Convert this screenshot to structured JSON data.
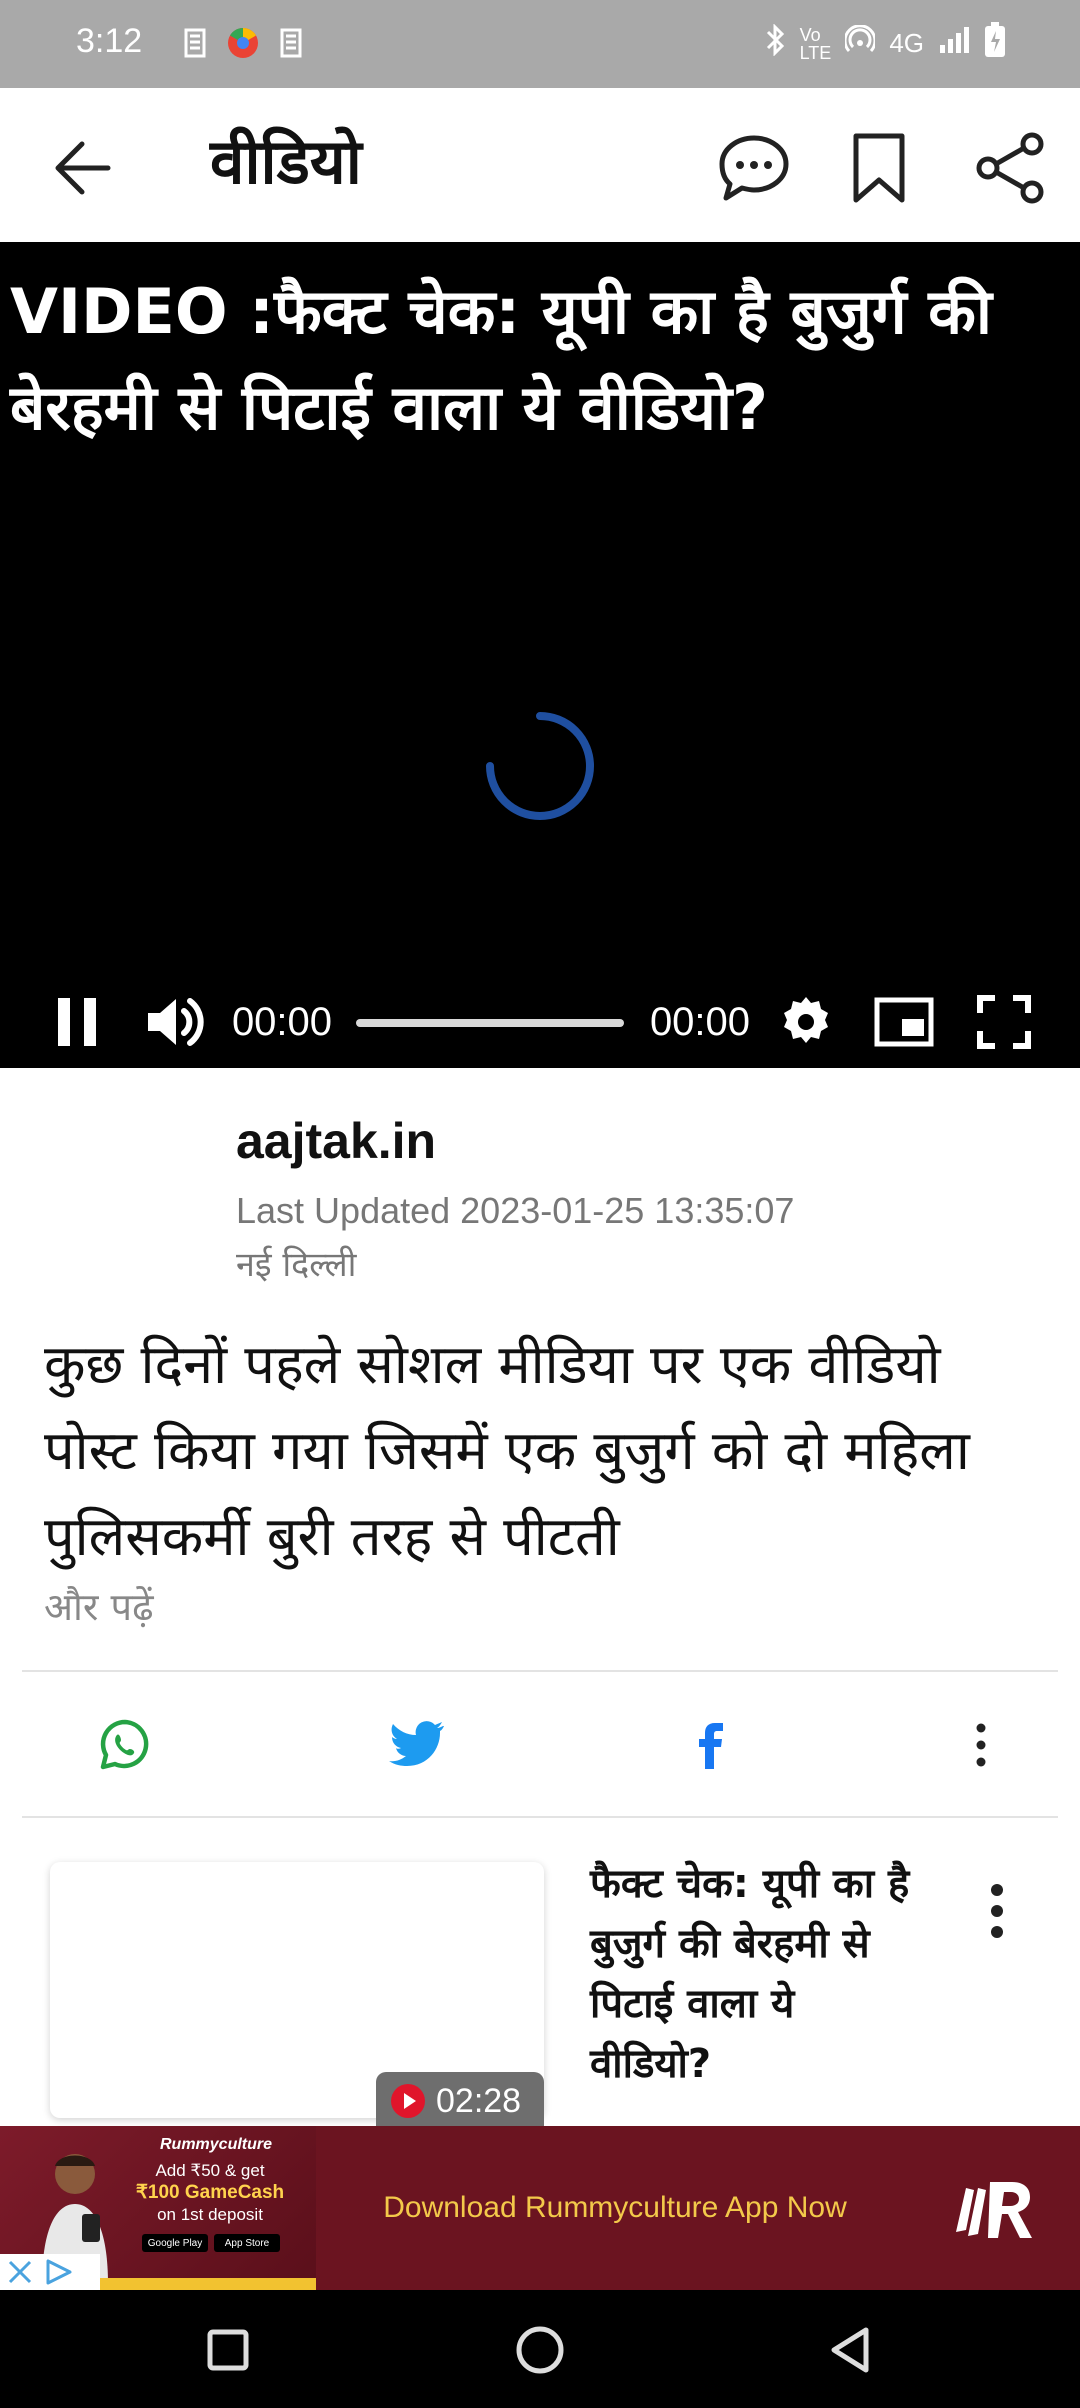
{
  "status_bar": {
    "time": "3:12",
    "network": "4G"
  },
  "app_bar": {
    "title": "वीडियो"
  },
  "video": {
    "title": "VIDEO :फैक्ट चेक: यूपी का है बुजुर्ग की बेरहमी से पिटाई वाला ये वीडियो?",
    "current_time": "00:00",
    "duration": "00:00",
    "progress": 0
  },
  "article": {
    "source": "aajtak.in",
    "last_updated": "Last Updated 2023-01-25 13:35:07",
    "location": "नई दिल्ली",
    "summary": "कुछ दिनों पहले सोशल मीडिया पर एक वीडियो पोस्ट किया गया जिसमें एक बुजुर्ग को दो महिला पुलिसकर्मी बुरी तरह से पीटती",
    "read_more": "और पढ़ें"
  },
  "related": {
    "title": "फैक्ट चेक: यूपी का है बुजुर्ग की बेरहमी से पिटाई वाला ये वीडियो?",
    "duration": "02:28"
  },
  "ad": {
    "brand": "Rummyculture",
    "offer_line1": "Add ₹50 & get",
    "offer_line2": "₹100 GameCash",
    "offer_line3": "on 1st deposit",
    "store1": "Google Play",
    "store2": "App Store",
    "cta": "Download Rummyculture App Now"
  },
  "colors": {
    "whatsapp": "#25a244",
    "twitter": "#1d9bf0",
    "facebook": "#1877f2",
    "ad_bg": "#6b1420",
    "ad_cta": "#f3c94a"
  }
}
